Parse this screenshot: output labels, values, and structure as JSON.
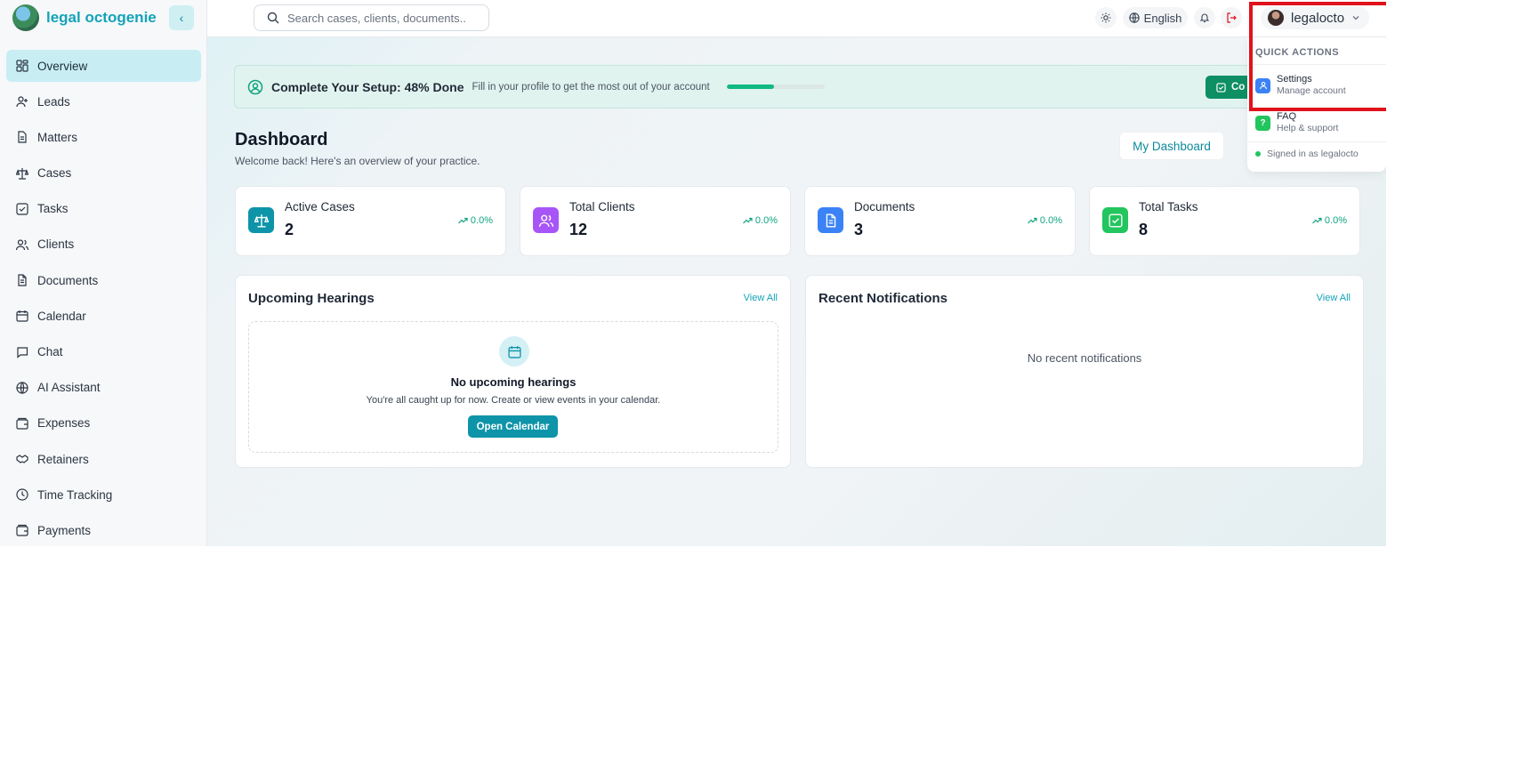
{
  "brand": {
    "name": "legal octogenie"
  },
  "sidebar": {
    "items": [
      {
        "label": "Overview",
        "icon": "grid-icon"
      },
      {
        "label": "Leads",
        "icon": "user-plus-icon"
      },
      {
        "label": "Matters",
        "icon": "file-text-icon"
      },
      {
        "label": "Cases",
        "icon": "scale-icon"
      },
      {
        "label": "Tasks",
        "icon": "check-square-icon"
      },
      {
        "label": "Clients",
        "icon": "users-icon"
      },
      {
        "label": "Documents",
        "icon": "file-icon"
      },
      {
        "label": "Calendar",
        "icon": "calendar-icon"
      },
      {
        "label": "Chat",
        "icon": "message-icon"
      },
      {
        "label": "AI Assistant",
        "icon": "globe-icon"
      },
      {
        "label": "Expenses",
        "icon": "wallet-icon"
      },
      {
        "label": "Retainers",
        "icon": "handshake-icon"
      },
      {
        "label": "Time Tracking",
        "icon": "clock-icon"
      },
      {
        "label": "Payments",
        "icon": "wallet-icon"
      }
    ]
  },
  "topbar": {
    "search_placeholder": "Search cases, clients, documents...",
    "language": "English",
    "user": "legalocto"
  },
  "setup": {
    "title": "Complete Your Setup: 48% Done",
    "subtitle": "Fill in your profile to get the most out of your account",
    "progress": 0.48,
    "button_label": "Co"
  },
  "dashboard": {
    "title": "Dashboard",
    "subtitle": "Welcome back! Here's an overview of your practice.",
    "my_dashboard": "My Dashboard"
  },
  "stats": [
    {
      "label": "Active Cases",
      "value": "2",
      "trend": "0.0%",
      "color": "#0e94a8",
      "icon": "scale-icon"
    },
    {
      "label": "Total Clients",
      "value": "12",
      "trend": "0.0%",
      "color": "#a855f7",
      "icon": "users-icon"
    },
    {
      "label": "Documents",
      "value": "3",
      "trend": "0.0%",
      "color": "#3b82f6",
      "icon": "file-icon"
    },
    {
      "label": "Total Tasks",
      "value": "8",
      "trend": "0.0%",
      "color": "#22c55e",
      "icon": "check-square-icon"
    }
  ],
  "hearings": {
    "title": "Upcoming Hearings",
    "view_all": "View All",
    "empty_title": "No upcoming hearings",
    "empty_sub": "You're all caught up for now. Create or view events in your calendar.",
    "button": "Open Calendar"
  },
  "notifications": {
    "title": "Recent Notifications",
    "view_all": "View All",
    "empty": "No recent notifications"
  },
  "dropdown": {
    "header": "QUICK ACTIONS",
    "items": [
      {
        "title": "Settings",
        "subtitle": "Manage account",
        "icon": "user-icon",
        "color": "#3b82f6"
      },
      {
        "title": "FAQ",
        "subtitle": "Help & support",
        "icon": "question-icon",
        "color": "#22c55e",
        "glyph": "?"
      }
    ],
    "signed_in": "Signed in as legalocto"
  },
  "colors": {
    "accent": "#14a3b8",
    "highlight": "#e0121b"
  }
}
